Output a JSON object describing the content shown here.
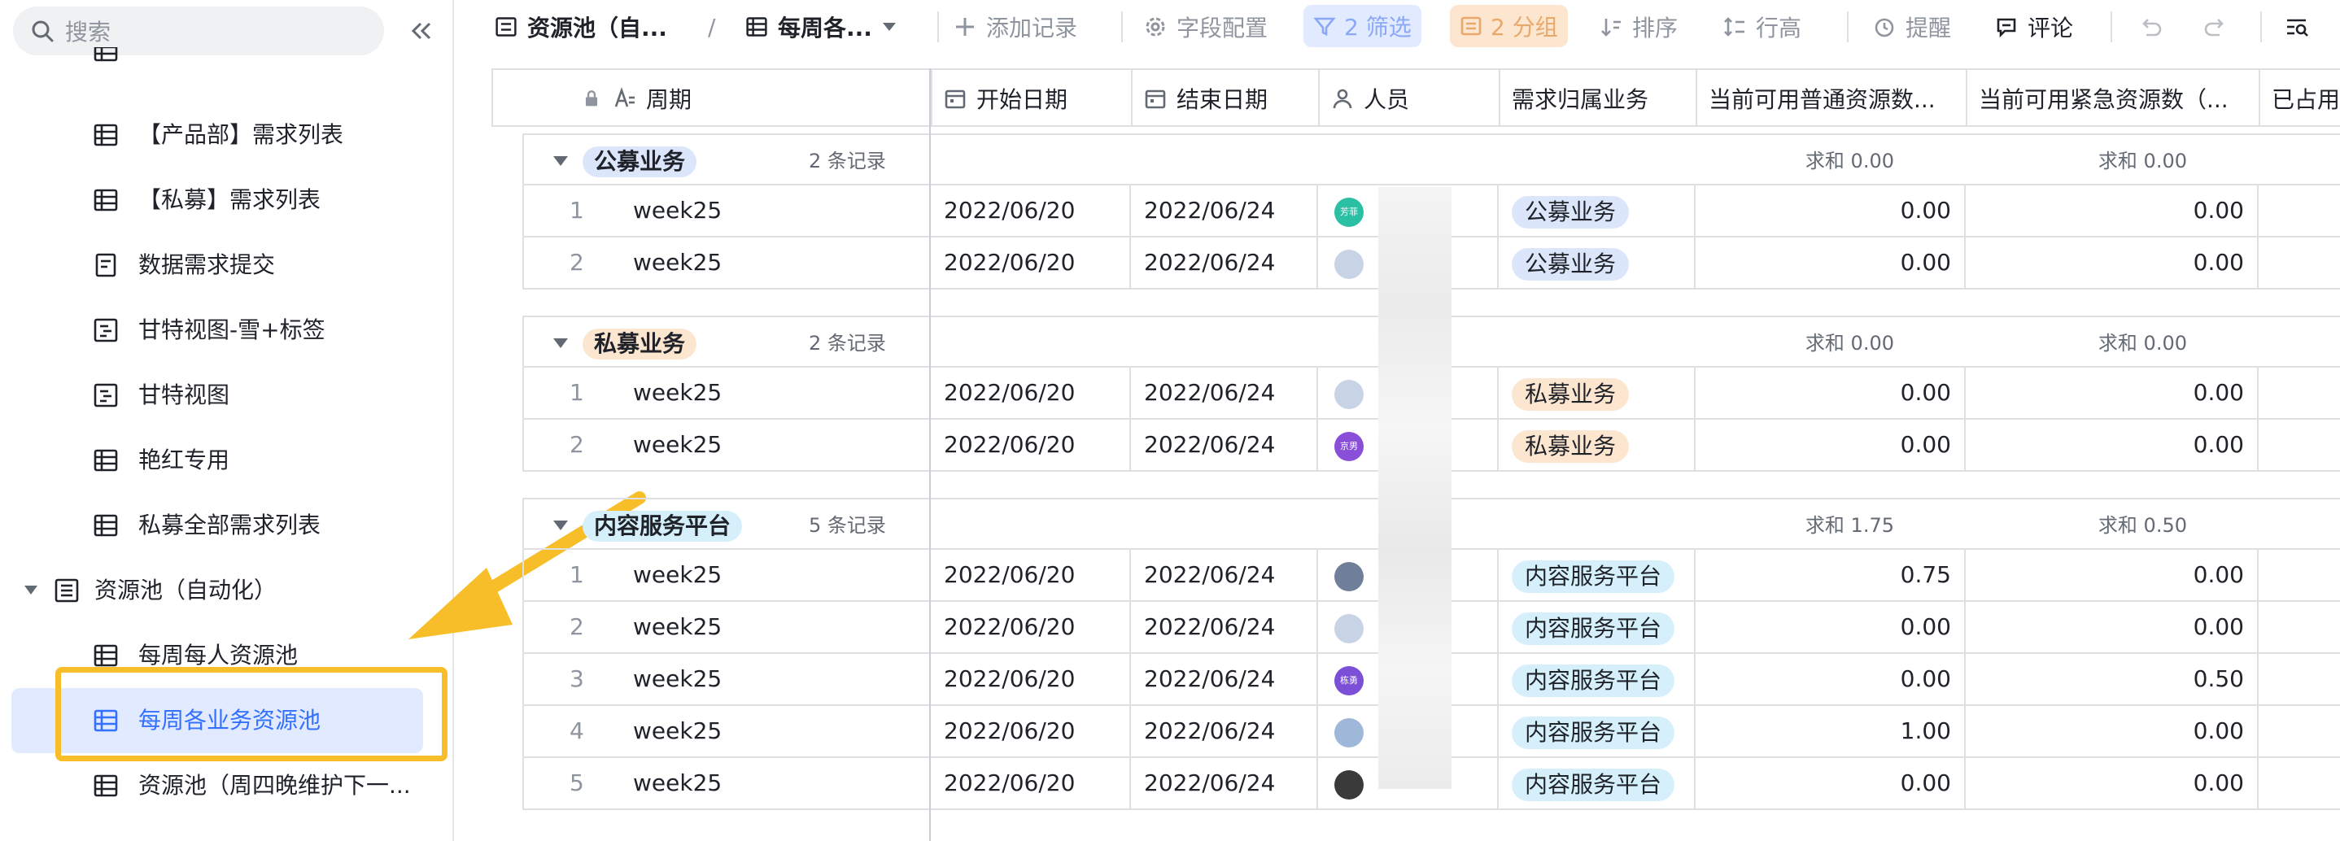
{
  "sidebar": {
    "search_placeholder": "搜索",
    "items": [
      {
        "label": "【产品部】需求列表"
      },
      {
        "label": "【私募】需求列表"
      },
      {
        "label": "数据需求提交"
      },
      {
        "label": "甘特视图-雪+标签"
      },
      {
        "label": "甘特视图"
      },
      {
        "label": "艳红专用"
      },
      {
        "label": "私募全部需求列表"
      },
      {
        "label": "资源池（自动化）"
      },
      {
        "label": "每周每人资源池"
      },
      {
        "label": "每周各业务资源池"
      },
      {
        "label": "资源池（周四晚维护下一..."
      }
    ]
  },
  "toolbar": {
    "table_tab": "资源池（自...",
    "view_tab": "每周各...",
    "add_record": "添加记录",
    "field_config": "字段配置",
    "filter": "2 筛选",
    "group": "2 分组",
    "sort": "排序",
    "row_height": "行高",
    "remind": "提醒",
    "comment": "评论"
  },
  "columns": [
    "周期",
    "开始日期",
    "结束日期",
    "人员",
    "需求归属业务",
    "当前可用普通资源数...",
    "当前可用紧急资源数（...",
    "已占用"
  ],
  "groups": [
    {
      "name": "公募业务",
      "count": "2 条记录",
      "sum_normal": "求和 0.00",
      "sum_urgent": "求和 0.00",
      "color": "#dce6fb",
      "rows": [
        {
          "idx": "1",
          "period": "week25",
          "start": "2022/06/20",
          "end": "2022/06/24",
          "avatar_text": "芳菲",
          "avatar_color": "#2bbfa4",
          "biz": "公募业务",
          "normal": "0.00",
          "urgent": "0.00"
        },
        {
          "idx": "2",
          "period": "week25",
          "start": "2022/06/20",
          "end": "2022/06/24",
          "avatar_text": "",
          "avatar_color": "#c8d4e6",
          "biz": "公募业务",
          "normal": "0.00",
          "urgent": "0.00"
        }
      ]
    },
    {
      "name": "私募业务",
      "count": "2 条记录",
      "sum_normal": "求和 0.00",
      "sum_urgent": "求和 0.00",
      "color": "#fde6d0",
      "rows": [
        {
          "idx": "1",
          "period": "week25",
          "start": "2022/06/20",
          "end": "2022/06/24",
          "avatar_text": "",
          "avatar_color": "#c8d4e6",
          "biz": "私募业务",
          "normal": "0.00",
          "urgent": "0.00"
        },
        {
          "idx": "2",
          "period": "week25",
          "start": "2022/06/20",
          "end": "2022/06/24",
          "avatar_text": "京男",
          "avatar_color": "#8a4fd9",
          "biz": "私募业务",
          "normal": "0.00",
          "urgent": "0.00"
        }
      ]
    },
    {
      "name": "内容服务平台",
      "count": "5 条记录",
      "sum_normal": "求和 1.75",
      "sum_urgent": "求和 0.50",
      "color": "#d6f0fb",
      "rows": [
        {
          "idx": "1",
          "period": "week25",
          "start": "2022/06/20",
          "end": "2022/06/24",
          "avatar_text": "",
          "avatar_color": "#6f7f99",
          "biz": "内容服务平台",
          "normal": "0.75",
          "urgent": "0.00"
        },
        {
          "idx": "2",
          "period": "week25",
          "start": "2022/06/20",
          "end": "2022/06/24",
          "avatar_text": "",
          "avatar_color": "#c8d4e6",
          "biz": "内容服务平台",
          "normal": "0.00",
          "urgent": "0.00"
        },
        {
          "idx": "3",
          "period": "week25",
          "start": "2022/06/20",
          "end": "2022/06/24",
          "avatar_text": "栋勇",
          "avatar_color": "#7b4fd6",
          "biz": "内容服务平台",
          "normal": "0.00",
          "urgent": "0.50"
        },
        {
          "idx": "4",
          "period": "week25",
          "start": "2022/06/20",
          "end": "2022/06/24",
          "avatar_text": "",
          "avatar_color": "#9fb7d8",
          "biz": "内容服务平台",
          "normal": "1.00",
          "urgent": "0.00"
        },
        {
          "idx": "5",
          "period": "week25",
          "start": "2022/06/20",
          "end": "2022/06/24",
          "avatar_text": "",
          "avatar_color": "#3a3a3a",
          "biz": "内容服务平台",
          "normal": "0.00",
          "urgent": "0.00"
        }
      ]
    }
  ],
  "colors": {
    "accent": "#3370ff",
    "highlight": "#f7be2a",
    "filter_bg": "#e1eaff",
    "group_bg": "#fde6d0"
  }
}
